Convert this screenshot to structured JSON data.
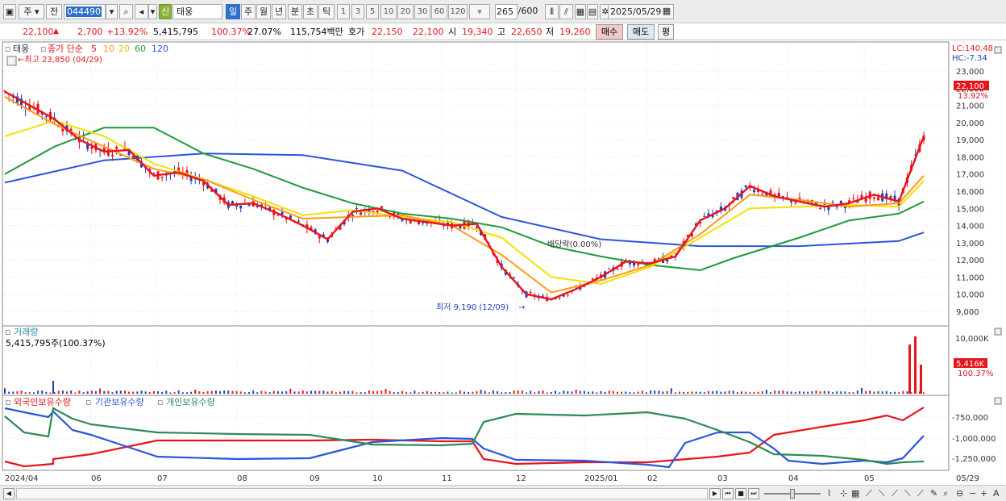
{
  "toolbar": {
    "type_label": "주",
    "prev_label": "전",
    "stock_code": "044490",
    "new_badge": "신",
    "stock_name": "태웅",
    "periods": [
      "일",
      "주",
      "월",
      "년",
      "분",
      "초",
      "틱"
    ],
    "active_period": "일",
    "intervals": [
      "1",
      "3",
      "5",
      "10",
      "20",
      "30",
      "60",
      "120"
    ],
    "count": "265",
    "count_max": "/600",
    "date": "2025/05/29"
  },
  "inforow": {
    "price": "22,100",
    "change_arrow": "▲",
    "change": "2,700",
    "change_pct": "+13.92%",
    "volume": "5,415,795",
    "vol_ratio": "100.37%",
    "turnover": "27.07%",
    "amount": "115,754백만",
    "ask_label": "호가",
    "ask1": "22,150",
    "ask2": "22,100",
    "open_label": "시",
    "open": "19,340",
    "high_label": "고",
    "high": "22,650",
    "low_label": "저",
    "low": "19,260",
    "buy_label": "매수",
    "sell_label": "매도",
    "eval_label": "평"
  },
  "price_panel": {
    "legend_name": "태웅",
    "legend_series": "종가 단순",
    "ma_periods": [
      "5",
      "10",
      "20",
      "60",
      "120"
    ],
    "ma_colors": [
      "#e8141c",
      "#ff9a1f",
      "#f4e000",
      "#1f9a3a",
      "#2a56d8"
    ],
    "high_note": "←최고 23,850 (04/29)",
    "low_note": "최저 9,190 (12/09)",
    "dividend_note": "배당락(0.00%)",
    "lc": "LC:140.48",
    "hc": "HC:-7.34",
    "last_price": "22,100",
    "last_pct": "13.92%",
    "y_ticks": [
      "23,000",
      "22,000",
      "21,000",
      "20,000",
      "19,000",
      "18,000",
      "17,000",
      "16,000",
      "15,000",
      "14,000",
      "13,000",
      "12,000",
      "11,000",
      "10,000",
      "9,000"
    ]
  },
  "volume_panel": {
    "title": "거래량",
    "value": "5,415,795주(100.37%)",
    "y_tick": "10,000K",
    "last_value": "5,416K",
    "last_pct": "100.37%"
  },
  "holdings_panel": {
    "series": [
      {
        "name": "외국인보유수량",
        "color": "#e8141c"
      },
      {
        "name": "기관보유수량",
        "color": "#2a56d8"
      },
      {
        "name": "개인보유수량",
        "color": "#2e8b57"
      }
    ],
    "y_ticks": [
      "-750,000",
      "-1,000,000",
      "-1,250,000"
    ]
  },
  "x_axis": {
    "labels": [
      "2024/04",
      "06",
      "07",
      "08",
      "09",
      "10",
      "11",
      "12",
      "2025/01",
      "02",
      "03",
      "04",
      "05",
      "05/29"
    ]
  },
  "chart_data": {
    "type": "line",
    "title": "",
    "x_range": [
      "2024/04",
      "2025/05/29"
    ],
    "ylim": [
      9000,
      23500
    ],
    "series": [
      {
        "name": "5",
        "color": "#e8141c",
        "points": [
          [
            0,
            21800
          ],
          [
            3,
            21000
          ],
          [
            6,
            20200
          ],
          [
            9,
            19000
          ],
          [
            12,
            18300
          ],
          [
            15,
            18400
          ],
          [
            18,
            16900
          ],
          [
            21,
            17100
          ],
          [
            24,
            16600
          ],
          [
            27,
            15200
          ],
          [
            30,
            15300
          ],
          [
            33,
            14700
          ],
          [
            36,
            14000
          ],
          [
            39,
            13200
          ],
          [
            42,
            14800
          ],
          [
            45,
            15000
          ],
          [
            48,
            14400
          ],
          [
            51,
            14200
          ],
          [
            54,
            14000
          ],
          [
            57,
            14100
          ],
          [
            60,
            11600
          ],
          [
            63,
            10000
          ],
          [
            66,
            9700
          ],
          [
            69,
            10300
          ],
          [
            72,
            11000
          ],
          [
            75,
            11900
          ],
          [
            78,
            11800
          ],
          [
            81,
            12200
          ],
          [
            84,
            14300
          ],
          [
            87,
            15000
          ],
          [
            90,
            16300
          ],
          [
            93,
            15700
          ],
          [
            96,
            15400
          ],
          [
            99,
            15100
          ],
          [
            102,
            15300
          ],
          [
            105,
            15800
          ],
          [
            108,
            15400
          ],
          [
            111,
            19200
          ]
        ]
      },
      {
        "name": "10",
        "color": "#ff9a1f",
        "points": [
          [
            0,
            21500
          ],
          [
            6,
            19900
          ],
          [
            12,
            18600
          ],
          [
            18,
            17300
          ],
          [
            24,
            16700
          ],
          [
            30,
            15500
          ],
          [
            36,
            14400
          ],
          [
            42,
            14500
          ],
          [
            48,
            14600
          ],
          [
            54,
            14000
          ],
          [
            60,
            12300
          ],
          [
            66,
            10100
          ],
          [
            72,
            10800
          ],
          [
            78,
            11700
          ],
          [
            84,
            13500
          ],
          [
            90,
            15800
          ],
          [
            96,
            15500
          ],
          [
            102,
            15100
          ],
          [
            108,
            15300
          ],
          [
            111,
            16900
          ]
        ]
      },
      {
        "name": "20",
        "color": "#f4e000",
        "points": [
          [
            0,
            19200
          ],
          [
            6,
            20100
          ],
          [
            12,
            19200
          ],
          [
            18,
            17600
          ],
          [
            24,
            16700
          ],
          [
            30,
            15700
          ],
          [
            36,
            14600
          ],
          [
            42,
            14900
          ],
          [
            48,
            14500
          ],
          [
            54,
            14200
          ],
          [
            60,
            13300
          ],
          [
            66,
            11000
          ],
          [
            72,
            10600
          ],
          [
            78,
            11600
          ],
          [
            84,
            13300
          ],
          [
            90,
            15000
          ],
          [
            96,
            15100
          ],
          [
            102,
            15200
          ],
          [
            108,
            15100
          ],
          [
            111,
            16600
          ]
        ]
      },
      {
        "name": "60",
        "color": "#1f9a3a",
        "points": [
          [
            0,
            17000
          ],
          [
            6,
            18600
          ],
          [
            12,
            19700
          ],
          [
            18,
            19700
          ],
          [
            24,
            18200
          ],
          [
            30,
            17300
          ],
          [
            36,
            16200
          ],
          [
            42,
            15300
          ],
          [
            48,
            14700
          ],
          [
            54,
            14400
          ],
          [
            60,
            13900
          ],
          [
            66,
            12800
          ],
          [
            72,
            12200
          ],
          [
            78,
            11700
          ],
          [
            84,
            11400
          ],
          [
            88,
            12100
          ],
          [
            96,
            13300
          ],
          [
            102,
            14300
          ],
          [
            108,
            14700
          ],
          [
            111,
            15400
          ]
        ]
      },
      {
        "name": "120",
        "color": "#2a56d8",
        "points": [
          [
            0,
            16500
          ],
          [
            12,
            17800
          ],
          [
            24,
            18200
          ],
          [
            36,
            18100
          ],
          [
            48,
            17200
          ],
          [
            60,
            14500
          ],
          [
            72,
            13200
          ],
          [
            84,
            12800
          ],
          [
            96,
            12800
          ],
          [
            108,
            13100
          ],
          [
            111,
            13600
          ]
        ]
      }
    ]
  }
}
